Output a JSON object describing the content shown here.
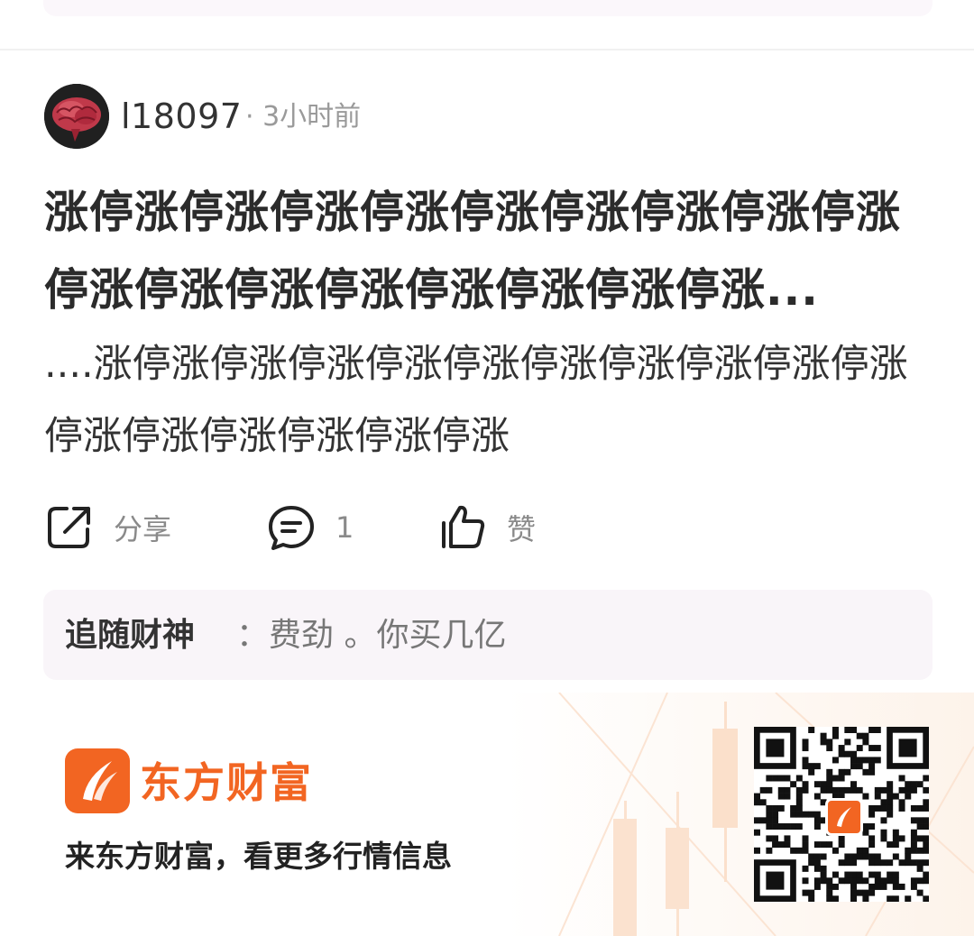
{
  "post": {
    "username": "l18097",
    "meta": "· 3小时前",
    "title": "涨停涨停涨停涨停涨停涨停涨停涨停涨停涨停涨停涨停涨停涨停涨停涨停涨停涨...",
    "body": "....涨停涨停涨停涨停涨停涨停涨停涨停涨停涨停涨停涨停涨停涨停涨停涨停涨",
    "actions": {
      "share_label": "分享",
      "comment_count": "1",
      "like_label": "赞"
    },
    "reply": {
      "author": "追随财神",
      "text": "：费劲 。你买几亿"
    }
  },
  "footer": {
    "brand_name": "东方财富",
    "slogan": "来东方财富，看更多行情信息"
  },
  "colors": {
    "brand_orange": "#f26522",
    "reply_bg": "#f9f5f9",
    "muted_text": "#9a9a9a"
  },
  "icons": [
    "avatar-brain-image",
    "share-icon",
    "comment-icon",
    "thumbs-up-icon",
    "eastmoney-logo-icon",
    "qr-code"
  ]
}
